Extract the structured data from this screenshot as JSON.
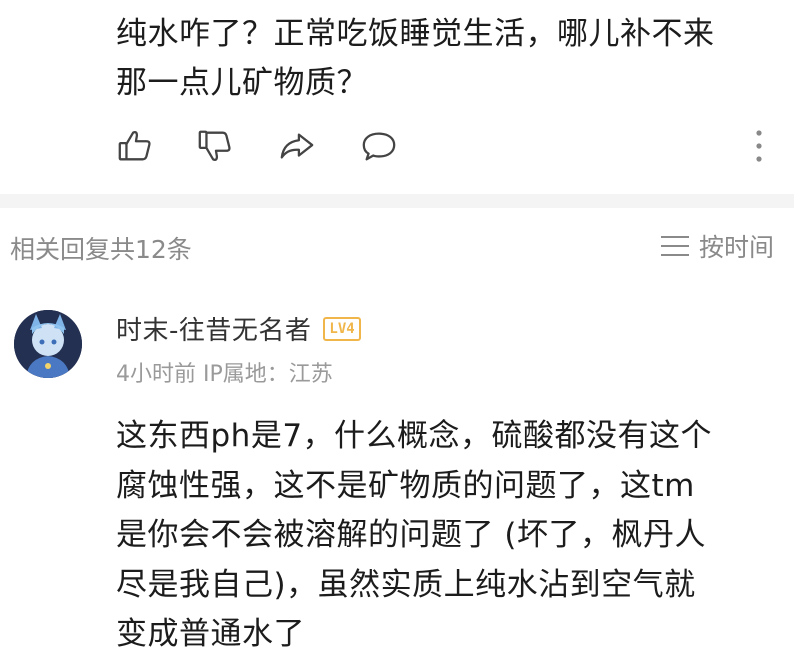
{
  "post": {
    "lines": [
      "纯水咋了？正常吃饭睡觉生活，哪儿补不来",
      "那一点儿矿物质？"
    ]
  },
  "actions": {
    "like_icon": "thumbs-up-icon",
    "dislike_icon": "thumbs-down-icon",
    "share_icon": "share-icon",
    "comment_icon": "comment-bubble-icon",
    "more_icon": "more-vertical-icon"
  },
  "replies": {
    "count_label": "相关回复共12条",
    "sort_label": "按时间",
    "sort_icon": "sort-lines-icon"
  },
  "comment": {
    "username": "时末-往昔无名者",
    "level": "LV4",
    "meta": "4小时前 IP属地：江苏",
    "lines": [
      "这东西ph是7，什么概念，硫酸都没有这个",
      "腐蚀性强，这不是矿物质的问题了，这tm",
      "是你会不会被溶解的问题了 (坏了，枫丹人",
      "尽是我自己)，虽然实质上纯水沾到空气就",
      "变成普通水了"
    ]
  },
  "colors": {
    "text": "#1c1c1c",
    "muted": "#8a8a8a",
    "level_badge": "#f0b64a",
    "divider": "#f4f4f4"
  }
}
